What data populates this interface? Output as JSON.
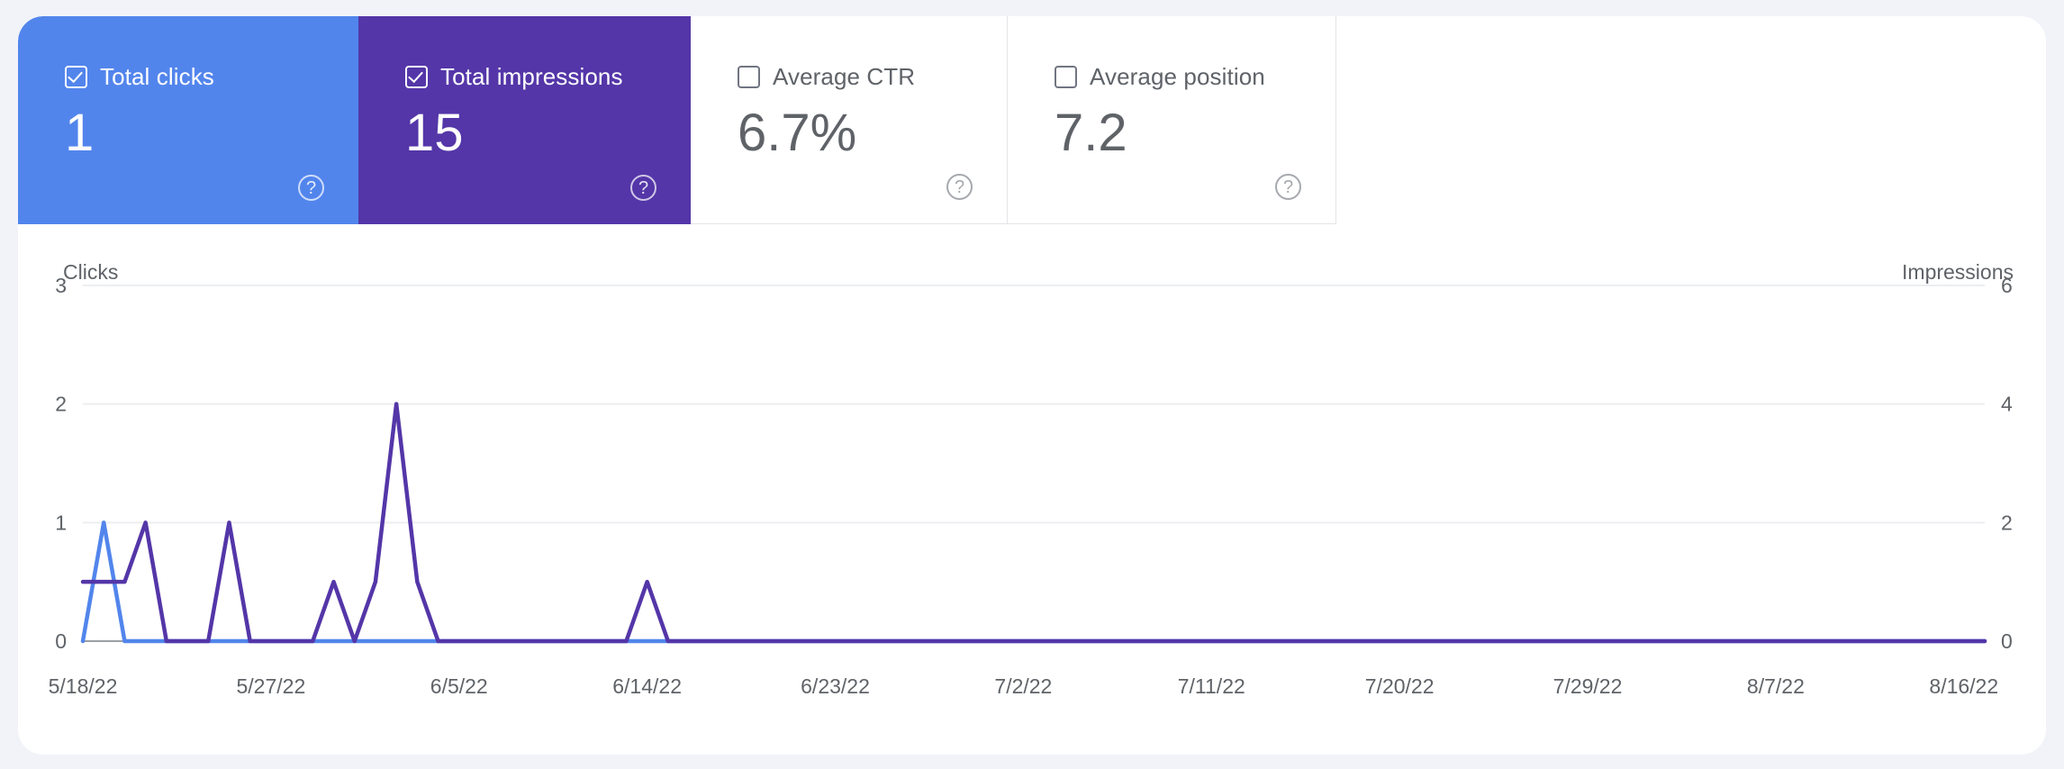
{
  "cards": [
    {
      "id": "total-clicks",
      "label": "Total clicks",
      "value": "1",
      "checked": true,
      "color": "#5285ec",
      "help": "?"
    },
    {
      "id": "total-impressions",
      "label": "Total impressions",
      "value": "15",
      "checked": true,
      "color": "#5436a8",
      "help": "?"
    },
    {
      "id": "average-ctr",
      "label": "Average CTR",
      "value": "6.7%",
      "checked": false,
      "color": "#ffffff",
      "help": "?"
    },
    {
      "id": "average-position",
      "label": "Average position",
      "value": "7.2",
      "checked": false,
      "color": "#ffffff",
      "help": "?"
    }
  ],
  "chart_data": {
    "type": "line",
    "title": "",
    "left_axis_title": "Clicks",
    "right_axis_title": "Impressions",
    "left_ticks": [
      "3",
      "2",
      "1",
      "0"
    ],
    "right_ticks": [
      "6",
      "4",
      "2",
      "0"
    ],
    "left_ylim": [
      0,
      3
    ],
    "right_ylim": [
      0,
      6
    ],
    "grid": true,
    "legend": "none",
    "x_tick_labels": [
      "5/18/22",
      "5/27/22",
      "6/5/22",
      "6/14/22",
      "6/23/22",
      "7/2/22",
      "7/11/22",
      "7/20/22",
      "7/29/22",
      "8/7/22",
      "8/16/22"
    ],
    "x_tick_days": [
      0,
      9,
      18,
      27,
      36,
      45,
      54,
      63,
      72,
      81,
      90
    ],
    "x_range_days": [
      0,
      91
    ],
    "series": [
      {
        "name": "Clicks",
        "axis": "left",
        "color": "#5285ec",
        "x": [
          0,
          1,
          2,
          3,
          4,
          5,
          6,
          7,
          8,
          9,
          10,
          11,
          12,
          13,
          14,
          15,
          16,
          17,
          18,
          19,
          20,
          21,
          22,
          23,
          24,
          25,
          26,
          27,
          28,
          29,
          30,
          31,
          32,
          33,
          34,
          35,
          36,
          37,
          38,
          39,
          40,
          41,
          42,
          43,
          44,
          45,
          46,
          47,
          48,
          49,
          50,
          51,
          52,
          53,
          54,
          55,
          56,
          57,
          58,
          59,
          60,
          61,
          62,
          63,
          64,
          65,
          66,
          67,
          68,
          69,
          70,
          71,
          72,
          73,
          74,
          75,
          76,
          77,
          78,
          79,
          80,
          81,
          82,
          83,
          84,
          85,
          86,
          87,
          88,
          89,
          90,
          91
        ],
        "values": [
          0,
          1,
          0,
          0,
          0,
          0,
          0,
          0,
          0,
          0,
          0,
          0,
          0,
          0,
          0,
          0,
          0,
          0,
          0,
          0,
          0,
          0,
          0,
          0,
          0,
          0,
          0,
          0,
          0,
          0,
          0,
          0,
          0,
          0,
          0,
          0,
          0,
          0,
          0,
          0,
          0,
          0,
          0,
          0,
          0,
          0,
          0,
          0,
          0,
          0,
          0,
          0,
          0,
          0,
          0,
          0,
          0,
          0,
          0,
          0,
          0,
          0,
          0,
          0,
          0,
          0,
          0,
          0,
          0,
          0,
          0,
          0,
          0,
          0,
          0,
          0,
          0,
          0,
          0,
          0,
          0,
          0,
          0,
          0,
          0,
          0,
          0,
          0,
          0,
          0,
          0,
          0
        ]
      },
      {
        "name": "Impressions",
        "axis": "right",
        "color": "#5436a8",
        "x": [
          0,
          1,
          2,
          3,
          4,
          5,
          6,
          7,
          8,
          9,
          10,
          11,
          12,
          13,
          14,
          15,
          16,
          17,
          18,
          19,
          20,
          21,
          22,
          23,
          24,
          25,
          26,
          27,
          28,
          29,
          30,
          31,
          32,
          33,
          34,
          35,
          36,
          37,
          38,
          39,
          40,
          41,
          42,
          43,
          44,
          45,
          46,
          47,
          48,
          49,
          50,
          51,
          52,
          53,
          54,
          55,
          56,
          57,
          58,
          59,
          60,
          61,
          62,
          63,
          64,
          65,
          66,
          67,
          68,
          69,
          70,
          71,
          72,
          73,
          74,
          75,
          76,
          77,
          78,
          79,
          80,
          81,
          82,
          83,
          84,
          85,
          86,
          87,
          88,
          89,
          90,
          91
        ],
        "values": [
          1,
          1,
          1,
          2,
          0,
          0,
          0,
          2,
          0,
          0,
          0,
          0,
          1,
          0,
          1,
          4,
          1,
          0,
          0,
          0,
          0,
          0,
          0,
          0,
          0,
          0,
          0,
          1,
          0,
          0,
          0,
          0,
          0,
          0,
          0,
          0,
          0,
          0,
          0,
          0,
          0,
          0,
          0,
          0,
          0,
          0,
          0,
          0,
          0,
          0,
          0,
          0,
          0,
          0,
          0,
          0,
          0,
          0,
          0,
          0,
          0,
          0,
          0,
          0,
          0,
          0,
          0,
          0,
          0,
          0,
          0,
          0,
          0,
          0,
          0,
          0,
          0,
          0,
          0,
          0,
          0,
          0,
          0,
          0,
          0,
          0,
          0,
          0,
          0,
          0,
          0,
          0
        ]
      }
    ]
  }
}
